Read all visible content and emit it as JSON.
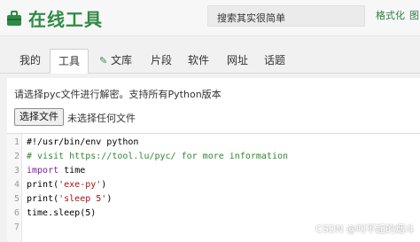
{
  "header": {
    "app_title": "在线工具",
    "search_placeholder": "搜索其实很简单",
    "format_label": "格式化",
    "extra_label": "图"
  },
  "tabs": [
    {
      "label": "我的"
    },
    {
      "label": "工具"
    },
    {
      "label": "文库",
      "icon": "brush-icon"
    },
    {
      "label": "片段"
    },
    {
      "label": "软件"
    },
    {
      "label": "网址"
    },
    {
      "label": "话题"
    }
  ],
  "main": {
    "description": "请选择pyc文件进行解密。支持所有Python版本",
    "choose_file_label": "选择文件",
    "file_status": "未选择任何文件"
  },
  "editor": {
    "line_numbers": [
      "1",
      "2",
      "3",
      "4",
      "5",
      "6",
      "7"
    ],
    "lines": [
      "#!/usr/bin/env python",
      "# visit https://tool.lu/pyc/ for more information",
      "time",
      "print(",
      "'exe-py'",
      "print(",
      "'sleep 5'",
      "time.sleep(5)"
    ],
    "import_kw": "import",
    "close_paren": ")"
  },
  "watermark": "CSDN @叼不起的烟斗",
  "colors": {
    "brand": "#2e8b45",
    "comment": "#2d8a2d",
    "keyword": "#7a1e9c",
    "string": "#a31515"
  }
}
